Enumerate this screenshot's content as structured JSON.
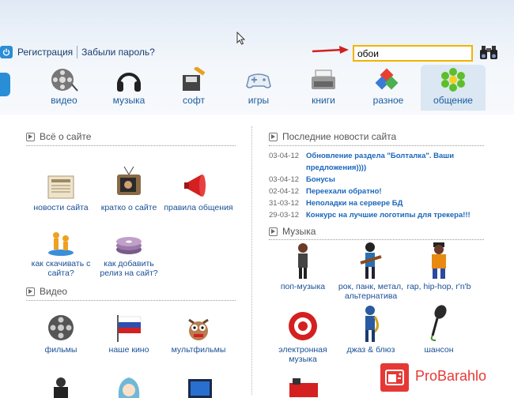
{
  "login": {
    "register": "Регистрация",
    "forgot": "Забыли пароль?"
  },
  "search": {
    "value": "обои"
  },
  "nav": [
    {
      "label": "видео",
      "icon": "film-reel-icon"
    },
    {
      "label": "музыка",
      "icon": "headphones-icon"
    },
    {
      "label": "софт",
      "icon": "software-icon"
    },
    {
      "label": "игры",
      "icon": "gamepad-icon"
    },
    {
      "label": "книги",
      "icon": "typewriter-icon"
    },
    {
      "label": "разное",
      "icon": "colored-blocks-icon"
    },
    {
      "label": "общение",
      "icon": "flower-icon"
    }
  ],
  "about": {
    "title": "Всё о сайте",
    "tiles": [
      "новости сайта",
      "кратко о сайте",
      "правила общения",
      "как скачивать с сайта?",
      "как добавить релиз на сайт?"
    ]
  },
  "video": {
    "title": "Видео",
    "tiles": [
      "фильмы",
      "наше кино",
      "мультфильмы"
    ]
  },
  "news": {
    "title": "Последние новости сайта",
    "items": [
      {
        "date": "03-04-12",
        "text": "Обновление раздела \"Болталка\". Ваши предложения))))"
      },
      {
        "date": "03-04-12",
        "text": "Бонусы"
      },
      {
        "date": "02-04-12",
        "text": "Переехали обратно!"
      },
      {
        "date": "31-03-12",
        "text": "Неполадки на сервере БД"
      },
      {
        "date": "29-03-12",
        "text": "Конкурс на лучшие логотипы для трекера!!!"
      }
    ]
  },
  "music": {
    "title": "Музыка",
    "tiles": [
      "поп-музыка",
      "рок, панк, метал, альтернатива",
      "rap, hip-hop, r'n'b",
      "электронная музыка",
      "джаз & блюз",
      "шансон"
    ]
  },
  "watermark": {
    "text": "ProBarahlo"
  },
  "colors": {
    "accent": "#1a66bb",
    "search_border": "#f0b400",
    "watermark": "#e53935"
  }
}
